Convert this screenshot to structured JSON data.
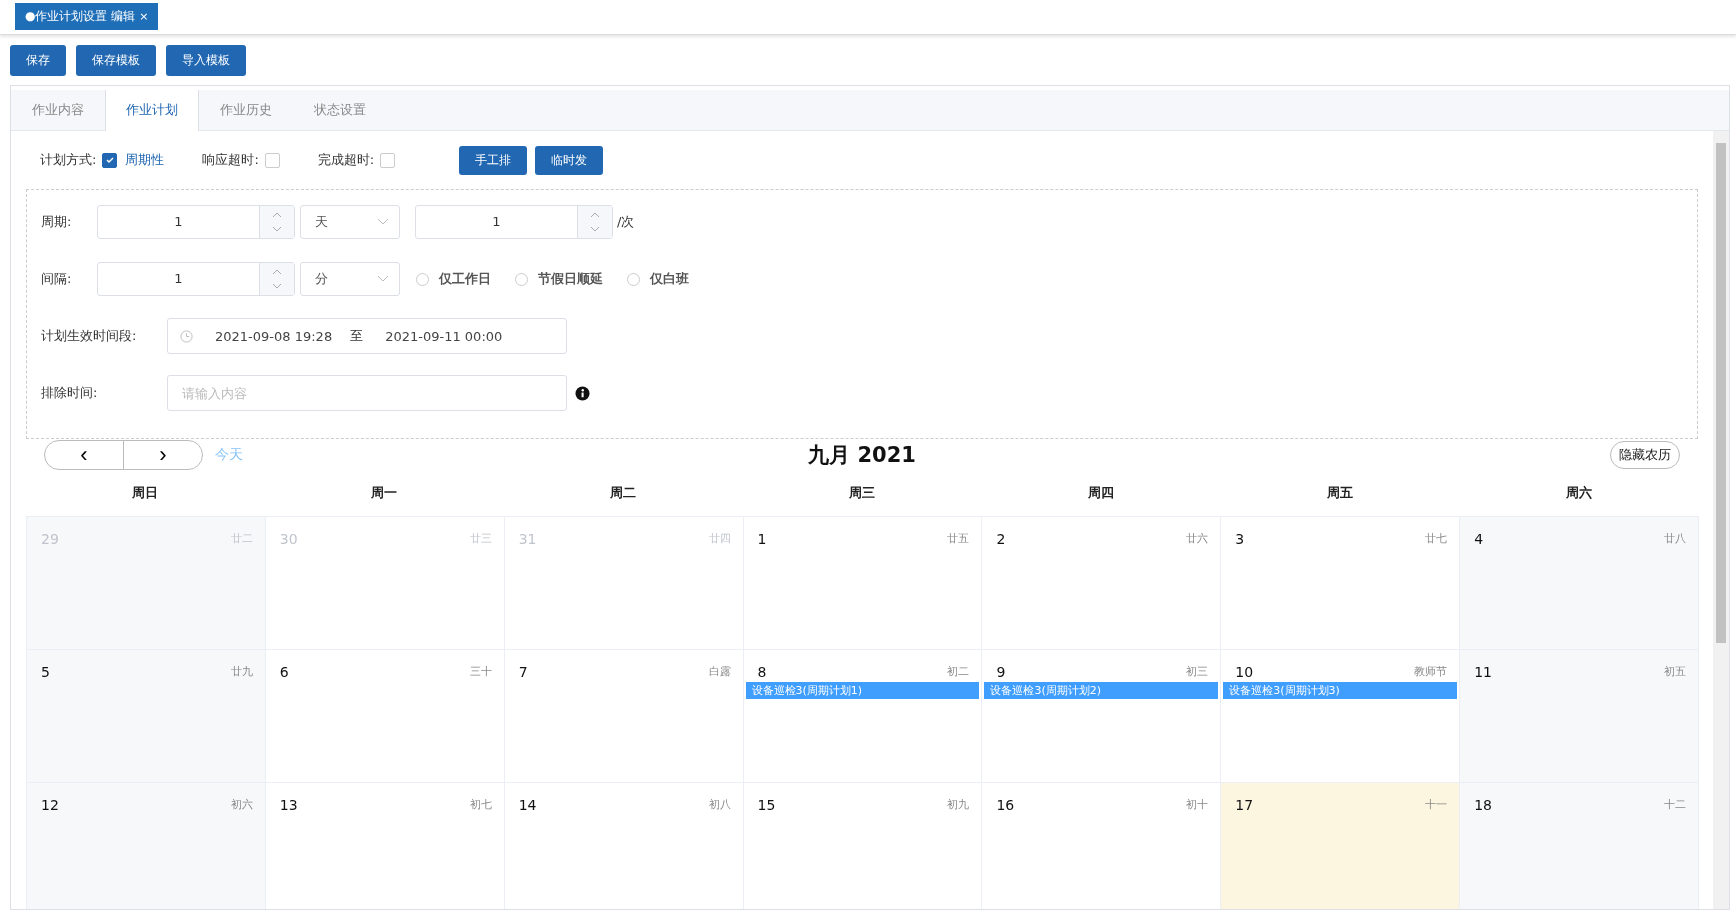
{
  "doc_tab": {
    "label": "●作业计划设置 编辑",
    "close": "×"
  },
  "toolbar": [
    "保存",
    "保存模板",
    "导入模板"
  ],
  "tabs": [
    {
      "label": "作业内容",
      "selected": false
    },
    {
      "label": "作业计划",
      "selected": true
    },
    {
      "label": "作业历史",
      "selected": false
    },
    {
      "label": "状态设置",
      "selected": false
    }
  ],
  "plan_row": {
    "label": "计划方式:",
    "mode": {
      "label": "周期性",
      "checked": true
    },
    "response_timeout": {
      "label": "响应超时:",
      "checked": false
    },
    "finish_timeout": {
      "label": "完成超时:",
      "checked": false
    },
    "buttons": [
      "手工排",
      "临时发"
    ]
  },
  "cycle": {
    "label": "周期:",
    "value": "1",
    "unit": "天",
    "count": "1",
    "count_suffix": "/次"
  },
  "interval": {
    "label": "间隔:",
    "value": "1",
    "unit": "分",
    "options": [
      {
        "label": "仅工作日",
        "selected": false
      },
      {
        "label": "节假日顺延",
        "selected": false
      },
      {
        "label": "仅白班",
        "selected": false
      }
    ]
  },
  "period": {
    "label": "计划生效时间段:",
    "start": "2021-09-08 19:28",
    "separator": "至",
    "end": "2021-09-11 00:00"
  },
  "exclude": {
    "label": "排除时间:",
    "placeholder": "请输入内容"
  },
  "calendar": {
    "prev": "‹",
    "next": "›",
    "today": "今天",
    "title": "九月 2021",
    "toggle": "隐藏农历",
    "weekdays": [
      "周日",
      "周一",
      "周二",
      "周三",
      "周四",
      "周五",
      "周六"
    ],
    "weeks": [
      [
        {
          "day": "29",
          "lunar": "廿二",
          "muted": true
        },
        {
          "day": "30",
          "lunar": "廿三",
          "muted": true
        },
        {
          "day": "31",
          "lunar": "廿四",
          "muted": true
        },
        {
          "day": "1",
          "lunar": "廿五",
          "muted": false
        },
        {
          "day": "2",
          "lunar": "廿六",
          "muted": false
        },
        {
          "day": "3",
          "lunar": "廿七",
          "muted": false
        },
        {
          "day": "4",
          "lunar": "廿八",
          "muted": false
        }
      ],
      [
        {
          "day": "5",
          "lunar": "廿九",
          "muted": false
        },
        {
          "day": "6",
          "lunar": "三十",
          "muted": false
        },
        {
          "day": "7",
          "lunar": "白露",
          "muted": false
        },
        {
          "day": "8",
          "lunar": "初二",
          "muted": false,
          "events": [
            "设备巡检3(周期计划1)"
          ]
        },
        {
          "day": "9",
          "lunar": "初三",
          "muted": false,
          "events": [
            "设备巡检3(周期计划2)"
          ]
        },
        {
          "day": "10",
          "lunar": "教师节",
          "muted": false,
          "events": [
            "设备巡检3(周期计划3)"
          ]
        },
        {
          "day": "11",
          "lunar": "初五",
          "muted": false
        }
      ],
      [
        {
          "day": "12",
          "lunar": "初六",
          "muted": false
        },
        {
          "day": "13",
          "lunar": "初七",
          "muted": false
        },
        {
          "day": "14",
          "lunar": "初八",
          "muted": false
        },
        {
          "day": "15",
          "lunar": "初九",
          "muted": false
        },
        {
          "day": "16",
          "lunar": "初十",
          "muted": false
        },
        {
          "day": "17",
          "lunar": "十一",
          "muted": false,
          "today": true
        },
        {
          "day": "18",
          "lunar": "十二",
          "muted": false
        }
      ]
    ]
  }
}
